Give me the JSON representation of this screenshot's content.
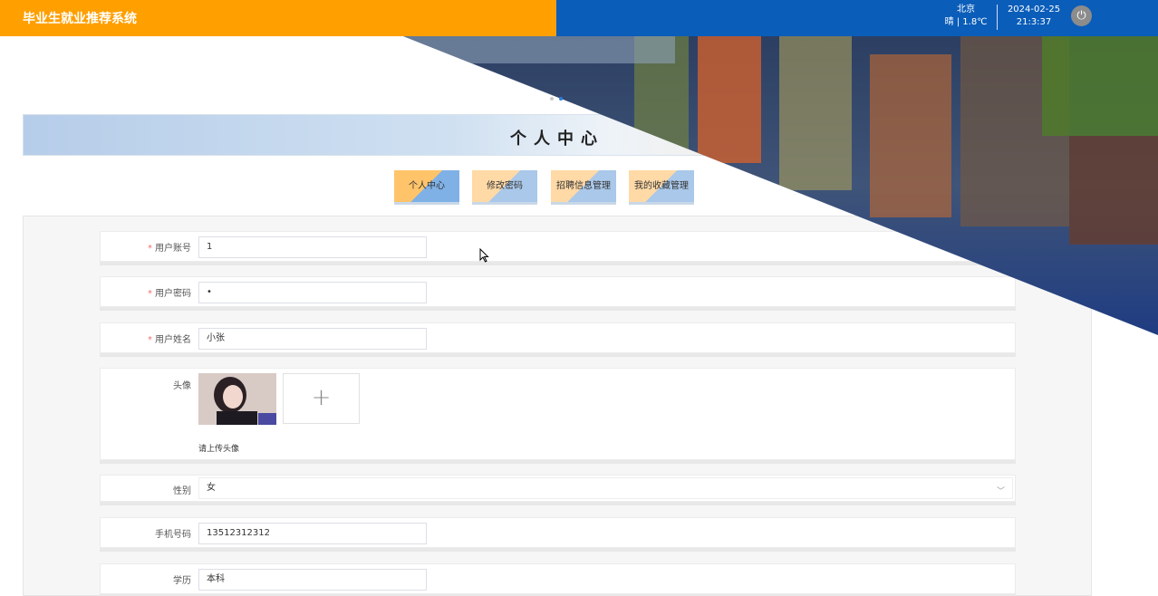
{
  "header": {
    "app_title": "毕业生就业推荐系统",
    "city": "北京",
    "weather": "晴 | 1.8℃",
    "date": "2024-02-25",
    "time": "21:3:37",
    "power_icon": "power-icon"
  },
  "carousel": {
    "slide_count": 2,
    "active_index": 1
  },
  "page_title": "个人中心",
  "tabs": [
    {
      "label": "个人中心",
      "active": true
    },
    {
      "label": "修改密码",
      "active": false
    },
    {
      "label": "招聘信息管理",
      "active": false
    },
    {
      "label": "我的收藏管理",
      "active": false
    }
  ],
  "form": {
    "account": {
      "label": "用户账号",
      "value": "1"
    },
    "password": {
      "label": "用户密码",
      "value": "•"
    },
    "name": {
      "label": "用户姓名",
      "value": "小张"
    },
    "avatar": {
      "label": "头像",
      "tip": "请上传头像",
      "add_icon": "plus-icon"
    },
    "gender": {
      "label": "性别",
      "value": "女"
    },
    "phone": {
      "label": "手机号码",
      "value": "13512312312"
    },
    "education": {
      "label": "学历",
      "value": "本科"
    }
  },
  "colors": {
    "brand_orange": "#ff9f00",
    "header_blue": "#0a5db9",
    "required_red": "#f56c6c"
  }
}
